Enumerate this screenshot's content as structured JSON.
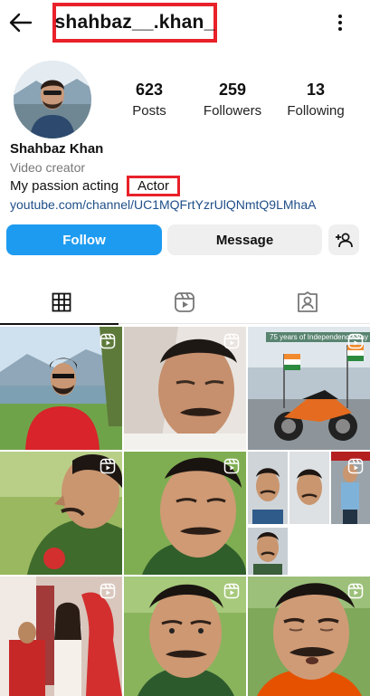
{
  "header": {
    "username": "shahbaz__.khan_",
    "back_icon": "arrow-left-icon",
    "more_icon": "more-vertical-icon"
  },
  "stats": {
    "posts_count": "623",
    "posts_label": "Posts",
    "followers_count": "259",
    "followers_label": "Followers",
    "following_count": "13",
    "following_label": "Following"
  },
  "bio": {
    "name": "Shahbaz Khan",
    "category": "Video creator",
    "text_prefix": "My passion acting",
    "text_highlight": "Actor",
    "link": "youtube.com/channel/UC1MQFrtYzrUlQNmtQ9LMhaA"
  },
  "actions": {
    "follow_label": "Follow",
    "message_label": "Message",
    "add_user_icon": "add-user-icon"
  },
  "tabs": [
    {
      "name": "posts",
      "icon": "grid-icon",
      "active": true
    },
    {
      "name": "reels",
      "icon": "reels-icon",
      "active": false
    },
    {
      "name": "tagged",
      "icon": "tagged-icon",
      "active": false
    }
  ],
  "grid": {
    "cells": [
      {
        "type": "reel",
        "scene": "man in red jacket by lake"
      },
      {
        "type": "reel",
        "scene": "man lying down close-up"
      },
      {
        "type": "reel",
        "scene": "motorbike with flags",
        "caption": "75 years of Independence Day"
      },
      {
        "type": "reel",
        "scene": "man profile in green shirt"
      },
      {
        "type": "reel",
        "scene": "man face close-up"
      },
      {
        "type": "reel",
        "scene": "collage of three photos"
      },
      {
        "type": "reel",
        "scene": "couple indoors"
      },
      {
        "type": "reel",
        "scene": "man face close-up green shirt"
      },
      {
        "type": "reel",
        "scene": "man eyes closed outdoors"
      }
    ]
  },
  "colors": {
    "accent_blue": "#1d9bf0",
    "link_blue": "#1f4f89",
    "highlight_red": "#e8212a",
    "button_gray": "#efefef"
  }
}
